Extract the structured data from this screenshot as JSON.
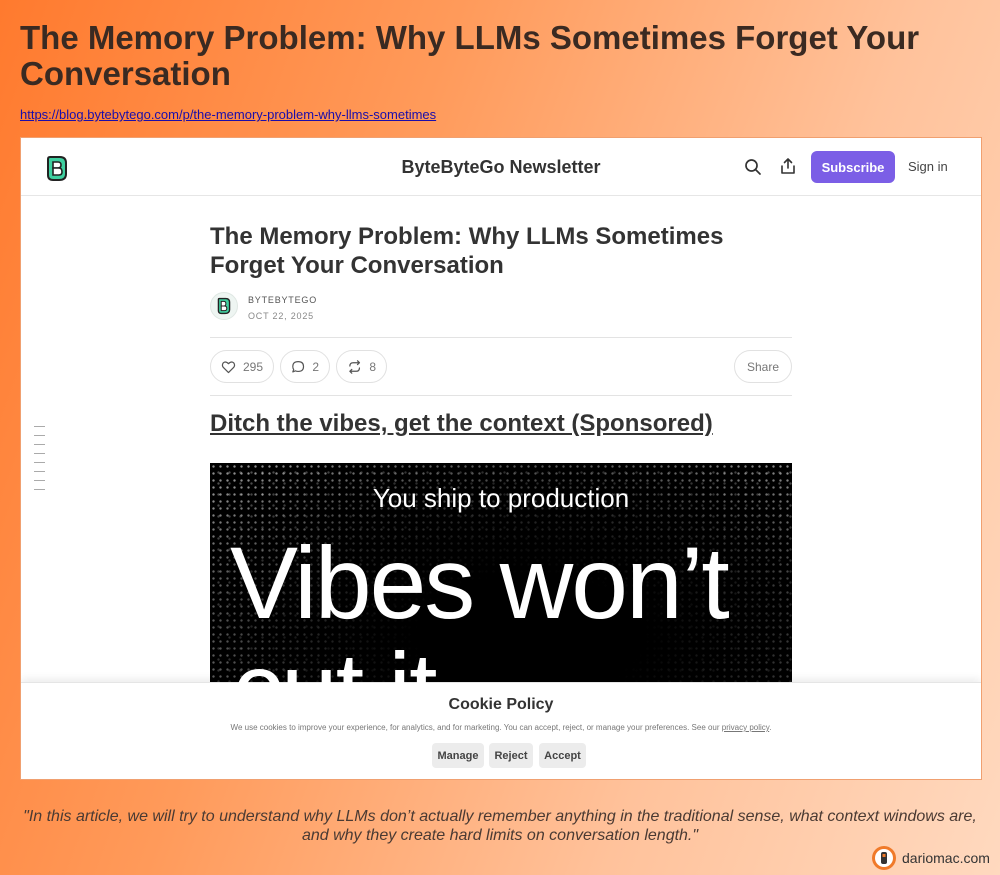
{
  "page": {
    "title": "The Memory Problem: Why LLMs Sometimes Forget Your Conversation",
    "url": "https://blog.bytebytego.com/p/the-memory-problem-why-llms-sometimes"
  },
  "header": {
    "newsletter_name": "ByteByteGo Newsletter",
    "subscribe_label": "Subscribe",
    "signin_label": "Sign in"
  },
  "article": {
    "title": "The Memory Problem: Why LLMs Sometimes Forget Your Conversation",
    "author": "BYTEBYTEGO",
    "date": "OCT 22, 2025",
    "likes": "295",
    "comments": "2",
    "restacks": "8",
    "share_label": "Share",
    "sponsored_heading": "Ditch the vibes, get the context (Sponsored)",
    "ad": {
      "line1": "You ship to production",
      "line2": "Vibes won’t",
      "line3": "cut it"
    }
  },
  "cookie": {
    "title": "Cookie Policy",
    "text": "We use cookies to improve your experience, for analytics, and for marketing. You can accept, reject, or manage your preferences. See our",
    "link_text": "privacy policy",
    "text_end": ".",
    "manage_label": "Manage",
    "reject_label": "Reject",
    "accept_label": "Accept"
  },
  "footer": {
    "quote": "\"In this article, we will try to understand why LLMs don’t actually remember anything in the traditional sense, what context windows are, and why they create hard limits on conversation length.\"",
    "brand": "dariomac.com"
  },
  "colors": {
    "accent": "#7b5ee6",
    "background_start": "#ff7a2e",
    "background_end": "#ffd9bf",
    "brand": "#f07a2a"
  }
}
